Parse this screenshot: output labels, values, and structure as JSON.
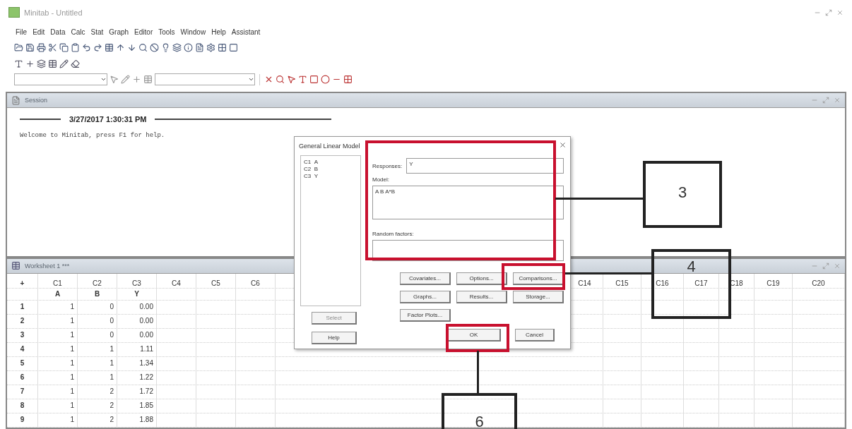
{
  "window": {
    "title": "Minitab - Untitled"
  },
  "menu": [
    "File",
    "Edit",
    "Data",
    "Calc",
    "Stat",
    "Graph",
    "Editor",
    "Tools",
    "Window",
    "Help",
    "Assistant"
  ],
  "session": {
    "title": "Session",
    "timestamp": "3/27/2017 1:30:31 PM",
    "message": "Welcome to Minitab, press F1 for help."
  },
  "worksheet": {
    "title": "Worksheet 1 ***",
    "corner": "+",
    "left_columns": [
      {
        "id": "C1",
        "name": "A"
      },
      {
        "id": "C2",
        "name": "B"
      },
      {
        "id": "C3",
        "name": "Y"
      },
      {
        "id": "C4"
      },
      {
        "id": "C5"
      },
      {
        "id": "C6"
      }
    ],
    "right_columns": [
      {
        "id": "C14"
      },
      {
        "id": "C15"
      },
      {
        "id": "C16"
      },
      {
        "id": "C17"
      },
      {
        "id": "C18"
      },
      {
        "id": "C19"
      },
      {
        "id": "C20"
      }
    ],
    "rows": [
      {
        "index": "1",
        "cells": [
          "1",
          "0",
          "0.00"
        ]
      },
      {
        "index": "2",
        "cells": [
          "1",
          "0",
          "0.00"
        ]
      },
      {
        "index": "3",
        "cells": [
          "1",
          "0",
          "0.00"
        ]
      },
      {
        "index": "4",
        "cells": [
          "1",
          "1",
          "1.11"
        ]
      },
      {
        "index": "5",
        "cells": [
          "1",
          "1",
          "1.34"
        ]
      },
      {
        "index": "6",
        "cells": [
          "1",
          "1",
          "1.22"
        ]
      },
      {
        "index": "7",
        "cells": [
          "1",
          "2",
          "1.72"
        ]
      },
      {
        "index": "8",
        "cells": [
          "1",
          "2",
          "1.85"
        ]
      },
      {
        "index": "9",
        "cells": [
          "1",
          "2",
          "1.88"
        ]
      }
    ]
  },
  "dialog": {
    "title": "General Linear Model",
    "variables": [
      {
        "id": "C1",
        "name": "A"
      },
      {
        "id": "C2",
        "name": "B"
      },
      {
        "id": "C3",
        "name": "Y"
      }
    ],
    "responses_label": "Responses:",
    "responses": "Y",
    "model_label": "Model:",
    "model": "A B A*B",
    "random_label": "Random factors:",
    "buttons": [
      {
        "label": "Covariates...",
        "disabled": false
      },
      {
        "label": "Options...",
        "disabled": false
      },
      {
        "label": "Comparisons...",
        "disabled": false
      },
      {
        "label": "Graphs...",
        "disabled": false
      },
      {
        "label": "Results...",
        "disabled": false
      },
      {
        "label": "Storage...",
        "disabled": false
      },
      {
        "label": "Factor Plots...",
        "disabled": false
      }
    ],
    "select": {
      "label": "Select",
      "disabled": true
    },
    "help": "Help",
    "ok": "OK",
    "cancel": "Cancel"
  },
  "annotations": [
    {
      "label": "3"
    },
    {
      "label": "4"
    },
    {
      "label": "6"
    }
  ]
}
